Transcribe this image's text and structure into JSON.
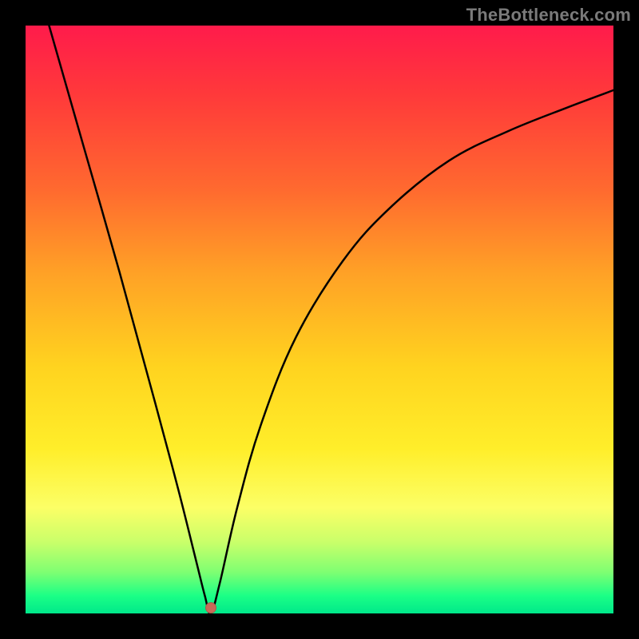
{
  "watermark": "TheBottleneck.com",
  "colors": {
    "frame": "#000000",
    "curve": "#000000",
    "dot": "#c96a58",
    "gradient_stops": [
      {
        "pos": 0.0,
        "hex": "#ff1b4b"
      },
      {
        "pos": 0.12,
        "hex": "#ff3a3a"
      },
      {
        "pos": 0.28,
        "hex": "#ff6a2f"
      },
      {
        "pos": 0.42,
        "hex": "#ffa126"
      },
      {
        "pos": 0.58,
        "hex": "#ffd31f"
      },
      {
        "pos": 0.72,
        "hex": "#ffee2a"
      },
      {
        "pos": 0.82,
        "hex": "#fcff66"
      },
      {
        "pos": 0.88,
        "hex": "#c8ff6a"
      },
      {
        "pos": 0.93,
        "hex": "#7eff72"
      },
      {
        "pos": 0.97,
        "hex": "#1bff86"
      },
      {
        "pos": 1.0,
        "hex": "#00e88a"
      }
    ]
  },
  "chart_data": {
    "type": "line",
    "title": "",
    "xlabel": "",
    "ylabel": "",
    "xlim": [
      0,
      100
    ],
    "ylim": [
      0,
      100
    ],
    "grid": false,
    "legend": false,
    "series": [
      {
        "name": "bottleneck-curve",
        "x": [
          4,
          10,
          16,
          22,
          26,
          29,
          30.5,
          31.5,
          33,
          36,
          40,
          46,
          54,
          62,
          72,
          82,
          92,
          100
        ],
        "y": [
          100,
          79,
          58,
          36,
          21,
          9,
          3,
          0,
          5,
          18,
          32,
          47,
          60,
          69,
          77,
          82,
          86,
          89
        ]
      }
    ],
    "marker": {
      "x": 31.5,
      "y": 1.0,
      "name": "balance-point"
    }
  }
}
